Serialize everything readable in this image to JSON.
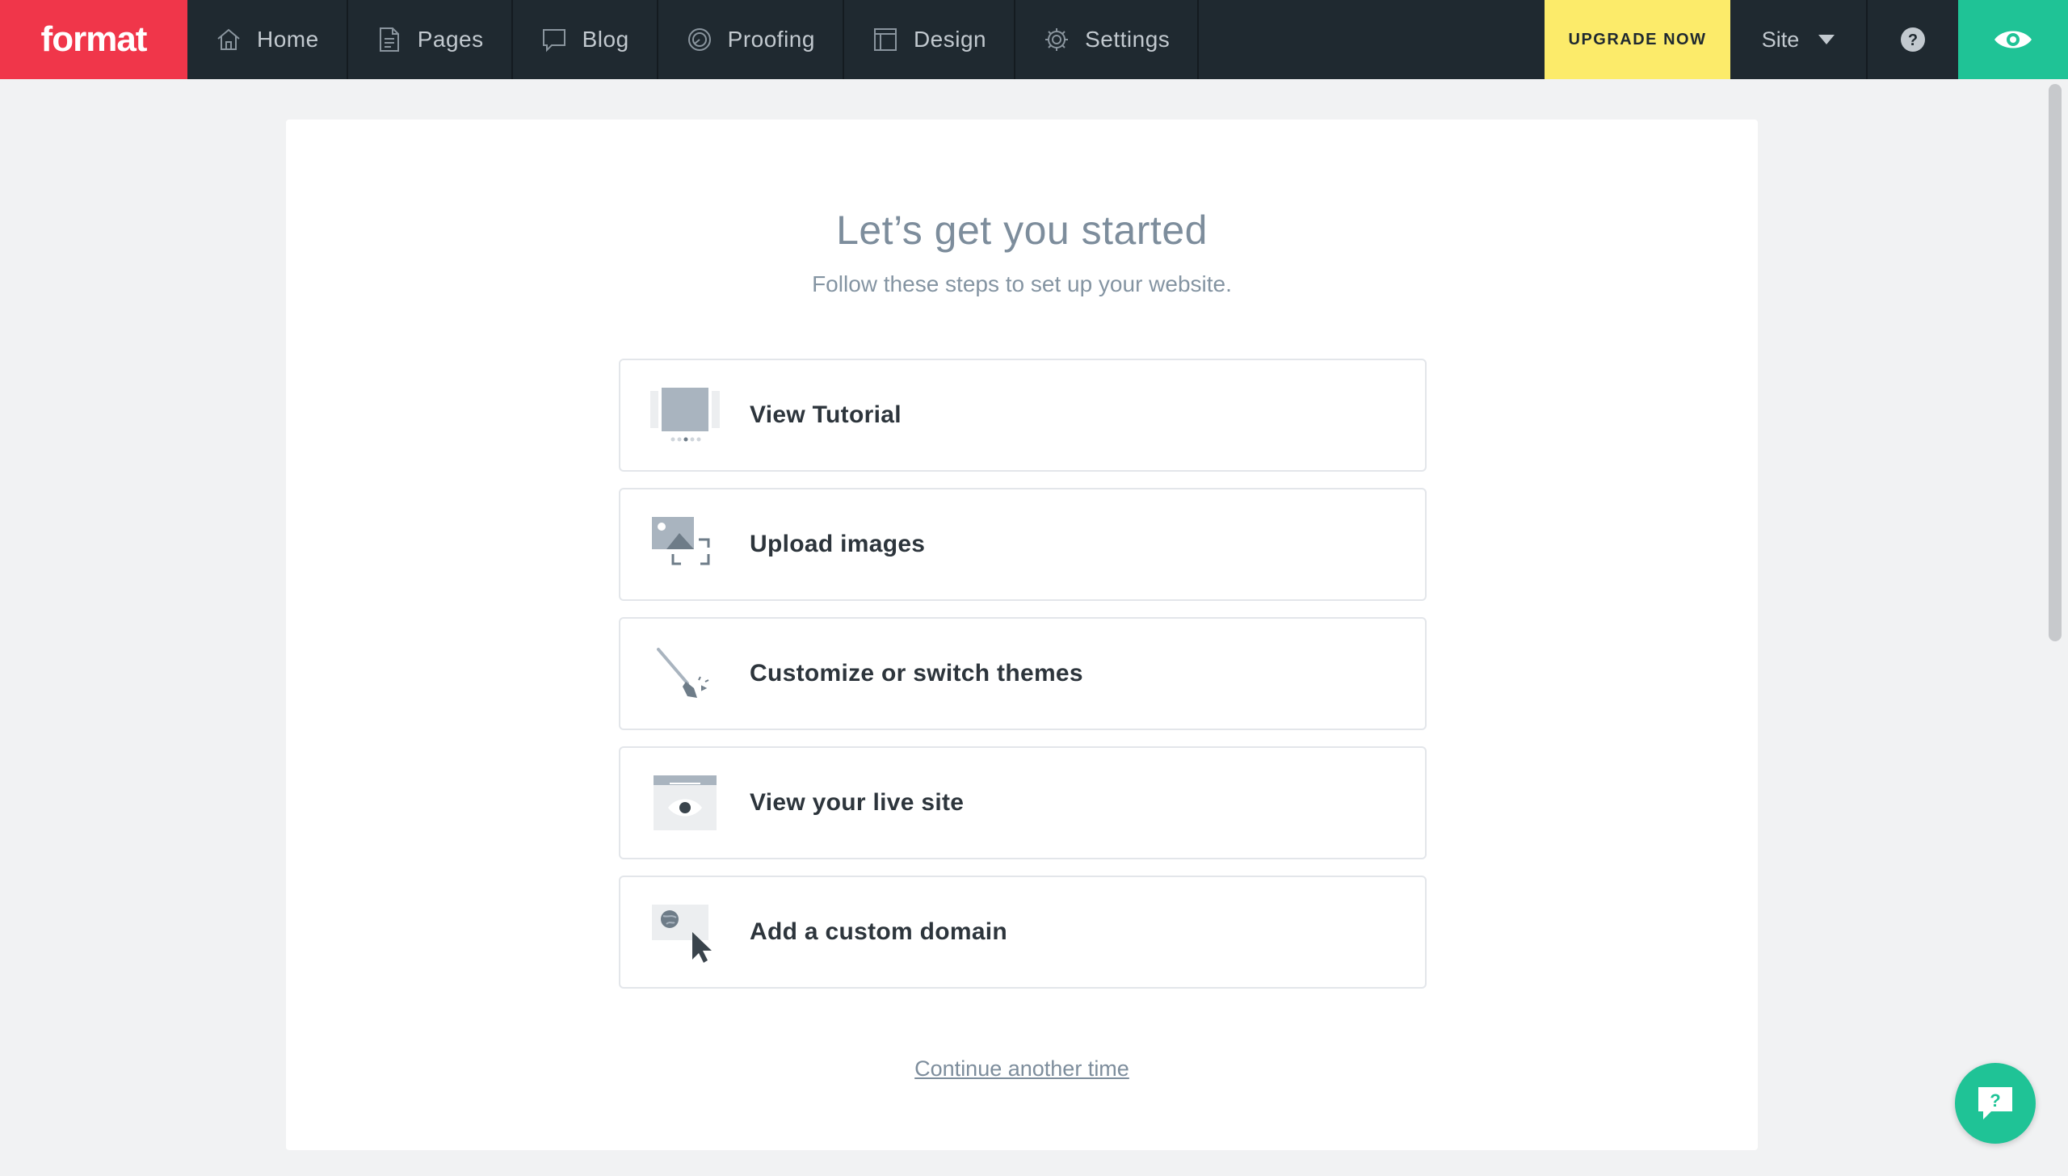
{
  "brand": {
    "logo_text": "format",
    "color": "#f0364a"
  },
  "nav": {
    "items": [
      {
        "label": "Home",
        "icon": "home-icon"
      },
      {
        "label": "Pages",
        "icon": "pages-icon"
      },
      {
        "label": "Blog",
        "icon": "blog-icon"
      },
      {
        "label": "Proofing",
        "icon": "proofing-icon"
      },
      {
        "label": "Design",
        "icon": "design-icon"
      },
      {
        "label": "Settings",
        "icon": "gear-icon"
      }
    ],
    "upgrade_label": "UPGRADE NOW",
    "site_select": {
      "selected": "Site"
    },
    "help_icon": "question-icon",
    "preview_icon": "eye-icon",
    "colors": {
      "bar": "#1f2930",
      "upgrade": "#fceb6a",
      "preview": "#1fc396"
    }
  },
  "main": {
    "title": "Let’s get you started",
    "subtitle": "Follow these steps to set up your website.",
    "steps": [
      {
        "label": "View Tutorial",
        "icon": "tutorial-icon"
      },
      {
        "label": "Upload images",
        "icon": "upload-images-icon"
      },
      {
        "label": "Customize or switch themes",
        "icon": "paintbrush-icon"
      },
      {
        "label": "View your live site",
        "icon": "live-site-icon"
      },
      {
        "label": "Add a custom domain",
        "icon": "custom-domain-icon"
      }
    ],
    "continue_label": "Continue another time"
  },
  "chat": {
    "icon": "chat-help-icon",
    "glyph": "?"
  }
}
